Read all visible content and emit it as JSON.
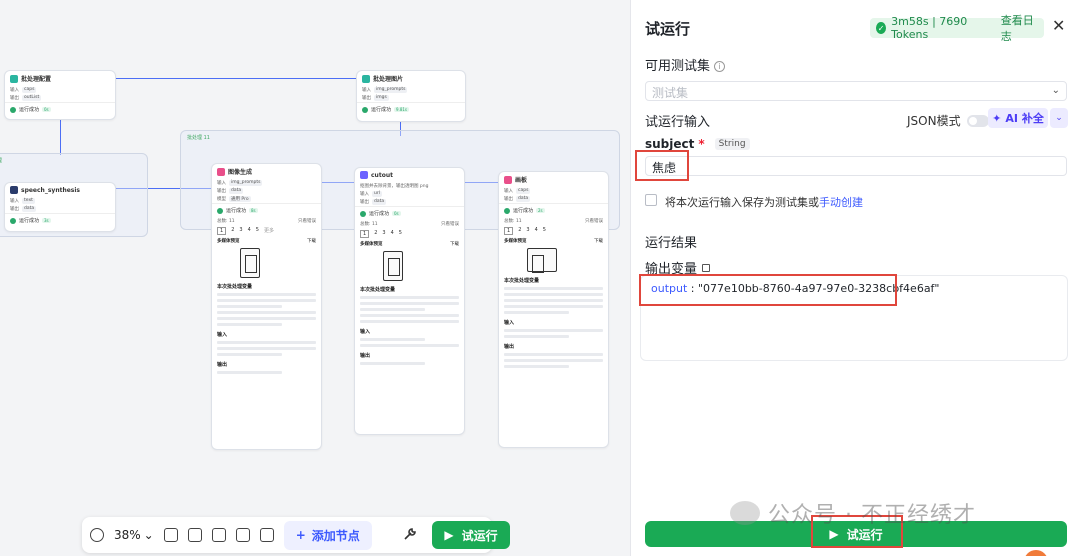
{
  "canvas": {
    "nodes": {
      "n1": {
        "title": "批处理配置",
        "row1": [
          "输入",
          "caps"
        ],
        "row2": [
          "输出",
          "outList"
        ],
        "status": "运行成功",
        "time": "0s"
      },
      "n2": {
        "title": "批处理图片",
        "row1": [
          "输入",
          "img_prompts"
        ],
        "row2": [
          "输出",
          "imgs"
        ],
        "status": "运行成功",
        "time": "9.81s"
      },
      "n3": {
        "title": "speech_synthesis",
        "row1": [
          "输入",
          "text"
        ],
        "row2": [
          "输出",
          "data"
        ],
        "status": "运行成功",
        "time": "3s"
      },
      "n4": {
        "title": "图像生成",
        "row1": [
          "输入",
          "img_prompts"
        ],
        "row2": [
          "输出",
          "data"
        ],
        "row3": [
          "模型",
          "通用 Pro"
        ],
        "status": "运行成功",
        "time": "8s",
        "tab_total": "总数: 11",
        "only_err": "只看错误",
        "pages": [
          "1",
          "2",
          "3",
          "4",
          "5"
        ],
        "more": "更多",
        "section_media": "多媒体预览",
        "download": "下载",
        "section_vars": "本次批处理变量",
        "section_input": "输入",
        "section_output": "输出"
      },
      "n5": {
        "title": "cutout",
        "desc": "抠图并去除背景，输出透明图 png",
        "row1": [
          "输入",
          "url"
        ],
        "row2": [
          "输出",
          "data"
        ],
        "status": "运行成功",
        "time": "0s",
        "tab_total": "总数: 11",
        "only_err": "只看错误",
        "pages": [
          "1",
          "2",
          "3",
          "4",
          "5"
        ],
        "section_media": "多媒体预览",
        "download": "下载",
        "section_vars": "本次批处理变量",
        "section_input": "输入",
        "section_output": "输出"
      },
      "n6": {
        "title": "画板",
        "row1": [
          "输入",
          "caps"
        ],
        "row2": [
          "输出",
          "data"
        ],
        "status": "运行成功",
        "time": "2s",
        "tab_total": "总数: 11",
        "only_err": "只看错误",
        "pages": [
          "1",
          "2",
          "3",
          "4",
          "5"
        ],
        "section_media": "多媒体预览",
        "download": "下载",
        "section_vars": "本次批处理变量",
        "section_input": "输入",
        "section_output": "输出"
      }
    },
    "group_label": "批处理 11",
    "group2_label": "理"
  },
  "toolbar": {
    "zoom": "38%",
    "add_node": "添加节点",
    "run": "试运行"
  },
  "panel": {
    "title": "试运行",
    "badge_text": "3m58s | 7690 Tokens",
    "badge_link": "查看日志",
    "testset_label": "可用测试集",
    "testset_placeholder": "测试集",
    "run_input_label": "试运行输入",
    "json_mode": "JSON模式",
    "ai_fill": "AI 补全",
    "subject_name": "subject",
    "subject_type": "String",
    "subject_value": "焦虑",
    "save_text": "将本次运行输入保存为测试集或",
    "save_link": "手动创建",
    "result_label": "运行结果",
    "output_var_label": "输出变量",
    "output_key": "output",
    "output_value": "\"077e10bb-8760-4a97-97e0-3238cbf4e6af\"",
    "run_button": "试运行"
  },
  "watermark": "公众号 · 不正经绣才",
  "colors": {
    "accent": "#1aaa55",
    "link": "#3d5afe",
    "highlight": "#e0463c"
  }
}
